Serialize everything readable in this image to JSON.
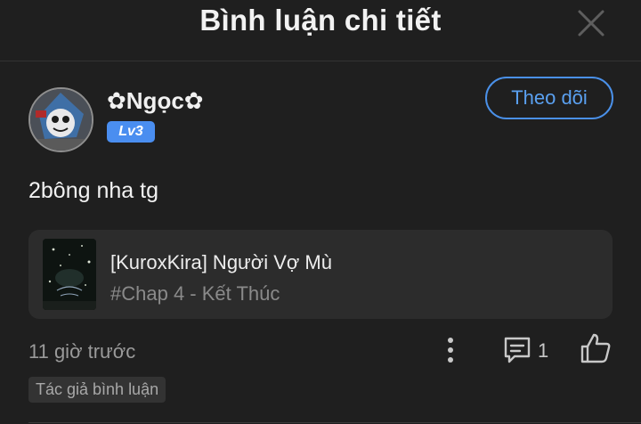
{
  "header": {
    "title": "Bình luận chi tiết",
    "close_icon": "close-icon"
  },
  "comment": {
    "author": {
      "name": "✿Ngọc✿",
      "level": "Lv3",
      "follow_label": "Theo dõi"
    },
    "text": "2bông nha tg",
    "manga": {
      "title": "[KuroxKira] Người Vợ Mù",
      "chapter": "#Chap 4 - Kết Thúc"
    },
    "time": "11 giờ trước",
    "reply_count": "1",
    "tag": "Tác giả bình luận",
    "icons": {
      "more": "more-vertical-icon",
      "reply": "comment-icon",
      "like": "thumbs-up-icon"
    }
  },
  "colors": {
    "background": "#1f1f1f",
    "accent": "#4a90e8",
    "card": "#2c2c2c"
  }
}
